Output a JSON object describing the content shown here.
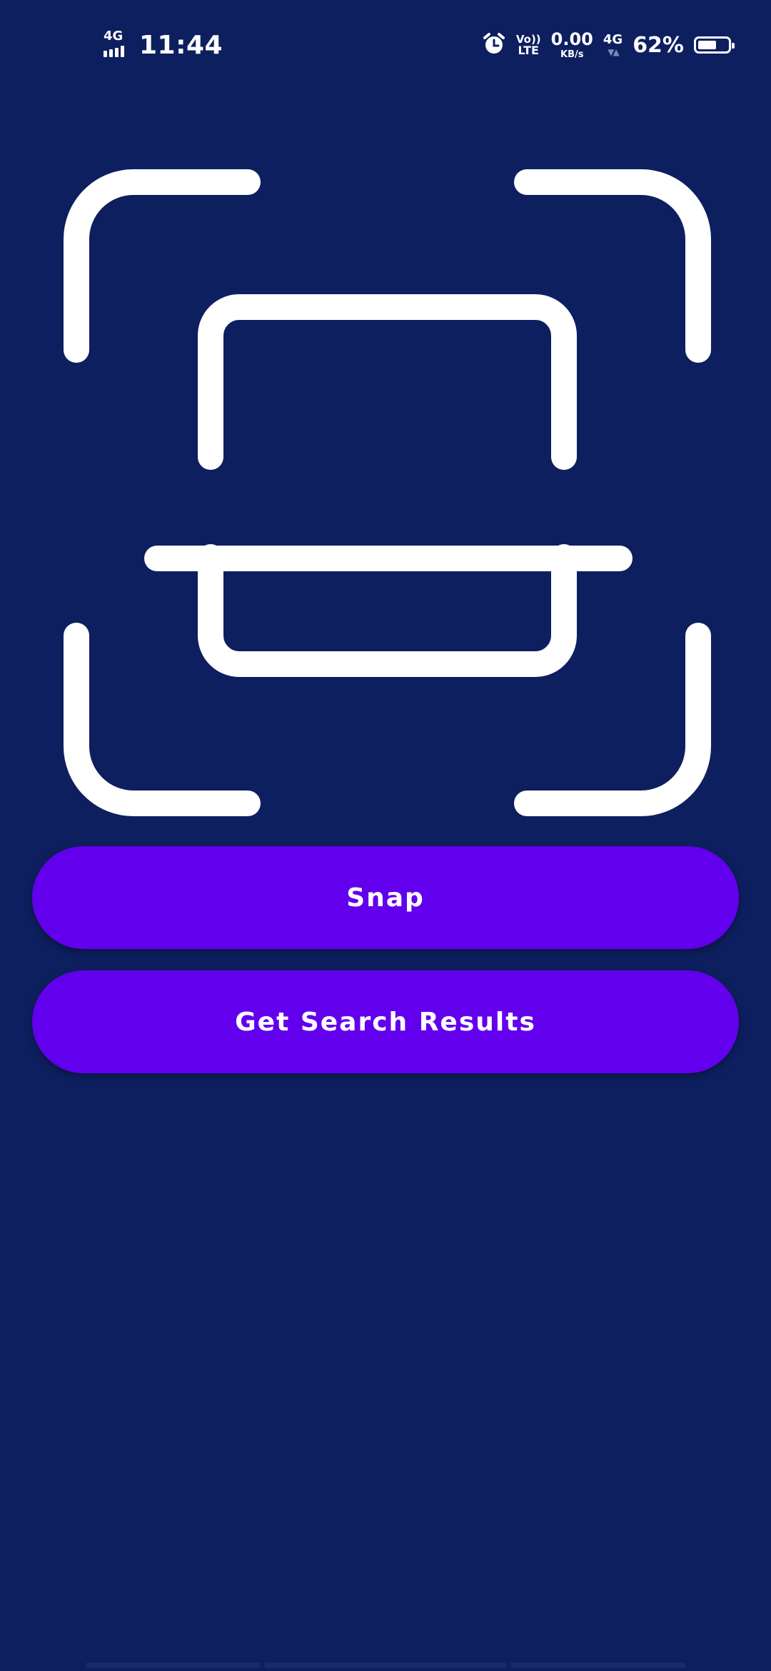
{
  "status_bar": {
    "left_network": "4G",
    "time": "11:44",
    "alarm_icon": "alarm-clock-icon",
    "volte_top": "Vo))",
    "volte_bottom": "LTE",
    "speed_value": "0.00",
    "speed_unit": "KB/s",
    "right_network": "4G",
    "battery_percent": "62%",
    "battery_level": 0.62
  },
  "scanner_icon": "document-scanner-icon",
  "buttons": {
    "snap_label": "Snap",
    "search_label": "Get Search Results"
  },
  "colors": {
    "background": "#0D1F5F",
    "button": "#6200EE",
    "icon": "#FFFFFF"
  }
}
